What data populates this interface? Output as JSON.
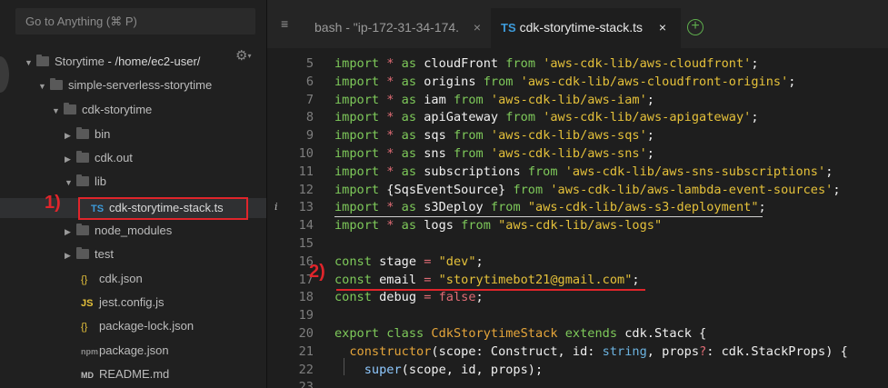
{
  "sidebar": {
    "search_placeholder": "Go to Anything (⌘ P)",
    "tree": {
      "root_name": "Storytime",
      "root_path": " - /home/ec2-user/",
      "folder1": "simple-serverless-storytime",
      "folder2": "cdk-storytime",
      "bin": "bin",
      "cdk_out": "cdk.out",
      "lib": "lib",
      "selected_file": "cdk-storytime-stack.ts",
      "node_modules": "node_modules",
      "test": "test",
      "cdk_json": "cdk.json",
      "jest_config": "jest.config.js",
      "package_lock": "package-lock.json",
      "package_json": "package.json",
      "readme": "README.md"
    },
    "icons": {
      "ts": "TS",
      "js": "JS",
      "json": "{}",
      "pkg": "npm",
      "md": "MD"
    }
  },
  "annotations": {
    "one": "1)",
    "two": "2)",
    "color": "#e0252b"
  },
  "tabs": {
    "bash_label": "bash - \"ip-172-31-34-174.",
    "ts_label": "cdk-storytime-stack.ts",
    "ts_badge": "TS",
    "close": "×",
    "add": "+"
  },
  "code": {
    "lines": [
      {
        "num": "5",
        "parts": [
          [
            "kw",
            "import "
          ],
          [
            "op",
            "* "
          ],
          [
            "kw",
            "as "
          ],
          [
            "vr",
            "cloudFront "
          ],
          [
            "kw",
            "from "
          ],
          [
            "str",
            "'aws-cdk-lib/aws-cloudfront'"
          ],
          [
            "vr",
            ";"
          ]
        ]
      },
      {
        "num": "6",
        "parts": [
          [
            "kw",
            "import "
          ],
          [
            "op",
            "* "
          ],
          [
            "kw",
            "as "
          ],
          [
            "vr",
            "origins "
          ],
          [
            "kw",
            "from "
          ],
          [
            "str",
            "'aws-cdk-lib/aws-cloudfront-origins'"
          ],
          [
            "vr",
            ";"
          ]
        ]
      },
      {
        "num": "7",
        "parts": [
          [
            "kw",
            "import "
          ],
          [
            "op",
            "* "
          ],
          [
            "kw",
            "as "
          ],
          [
            "vr",
            "iam "
          ],
          [
            "kw",
            "from "
          ],
          [
            "str",
            "'aws-cdk-lib/aws-iam'"
          ],
          [
            "vr",
            ";"
          ]
        ]
      },
      {
        "num": "8",
        "parts": [
          [
            "kw",
            "import "
          ],
          [
            "op",
            "* "
          ],
          [
            "kw",
            "as "
          ],
          [
            "vr",
            "apiGateway "
          ],
          [
            "kw",
            "from "
          ],
          [
            "str",
            "'aws-cdk-lib/aws-apigateway'"
          ],
          [
            "vr",
            ";"
          ]
        ]
      },
      {
        "num": "9",
        "parts": [
          [
            "kw",
            "import "
          ],
          [
            "op",
            "* "
          ],
          [
            "kw",
            "as "
          ],
          [
            "vr",
            "sqs "
          ],
          [
            "kw",
            "from "
          ],
          [
            "str",
            "'aws-cdk-lib/aws-sqs'"
          ],
          [
            "vr",
            ";"
          ]
        ]
      },
      {
        "num": "10",
        "parts": [
          [
            "kw",
            "import "
          ],
          [
            "op",
            "* "
          ],
          [
            "kw",
            "as "
          ],
          [
            "vr",
            "sns "
          ],
          [
            "kw",
            "from "
          ],
          [
            "str",
            "'aws-cdk-lib/aws-sns'"
          ],
          [
            "vr",
            ";"
          ]
        ]
      },
      {
        "num": "11",
        "parts": [
          [
            "kw",
            "import "
          ],
          [
            "op",
            "* "
          ],
          [
            "kw",
            "as "
          ],
          [
            "vr",
            "subscriptions "
          ],
          [
            "kw",
            "from "
          ],
          [
            "str",
            "'aws-cdk-lib/aws-sns-subscriptions'"
          ],
          [
            "vr",
            ";"
          ]
        ]
      },
      {
        "num": "12",
        "parts": [
          [
            "kw",
            "import "
          ],
          [
            "vr",
            "{SqsEventSource} "
          ],
          [
            "kw",
            "from "
          ],
          [
            "str",
            "'aws-cdk-lib/aws-lambda-event-sources'"
          ],
          [
            "vr",
            ";"
          ]
        ]
      },
      {
        "num": "13",
        "parts": [
          [
            "kw",
            "import "
          ],
          [
            "op",
            "* "
          ],
          [
            "kw",
            "as "
          ],
          [
            "vr",
            "s3Deploy "
          ],
          [
            "kw",
            "from "
          ],
          [
            "str",
            "\"aws-cdk-lib/aws-s3-deployment\""
          ],
          [
            "vr",
            ";"
          ]
        ]
      },
      {
        "num": "14",
        "parts": [
          [
            "kw",
            "import "
          ],
          [
            "op",
            "* "
          ],
          [
            "kw",
            "as "
          ],
          [
            "vr",
            "logs "
          ],
          [
            "kw",
            "from "
          ],
          [
            "str",
            "\"aws-cdk-lib/aws-logs\""
          ]
        ]
      },
      {
        "num": "15",
        "parts": []
      },
      {
        "num": "16",
        "parts": [
          [
            "kw",
            "const "
          ],
          [
            "vr",
            "stage "
          ],
          [
            "op",
            "= "
          ],
          [
            "str",
            "\"dev\""
          ],
          [
            "vr",
            ";"
          ]
        ]
      },
      {
        "num": "17",
        "parts": [
          [
            "kw",
            "const "
          ],
          [
            "vr",
            "email "
          ],
          [
            "op",
            "= "
          ],
          [
            "str",
            "\"storytimebot21@gmail.com\""
          ],
          [
            "vr",
            ";"
          ]
        ]
      },
      {
        "num": "18",
        "parts": [
          [
            "kw",
            "const "
          ],
          [
            "vr",
            "debug "
          ],
          [
            "op",
            "= "
          ],
          [
            "op",
            "false"
          ],
          [
            "vr",
            ";"
          ]
        ]
      },
      {
        "num": "19",
        "parts": []
      },
      {
        "num": "20",
        "parts": [
          [
            "kw",
            "export class "
          ],
          [
            "cls",
            "CdkStorytimeStack "
          ],
          [
            "kw",
            "extends "
          ],
          [
            "vr",
            "cdk.Stack {"
          ]
        ]
      },
      {
        "num": "21",
        "parts": [
          [
            "vr",
            "  "
          ],
          [
            "fn",
            "constructor"
          ],
          [
            "vr",
            "(scope: Construct, id: "
          ],
          [
            "ty",
            "string"
          ],
          [
            "vr",
            ", props"
          ],
          [
            "op",
            "?"
          ],
          [
            "vr",
            ": cdk.StackProps) {"
          ]
        ]
      },
      {
        "num": "22",
        "parts": [
          [
            "vr",
            "    "
          ],
          [
            "rc",
            "super"
          ],
          [
            "vr",
            "(scope, id, props);"
          ]
        ]
      },
      {
        "num": "23",
        "parts": []
      }
    ]
  }
}
